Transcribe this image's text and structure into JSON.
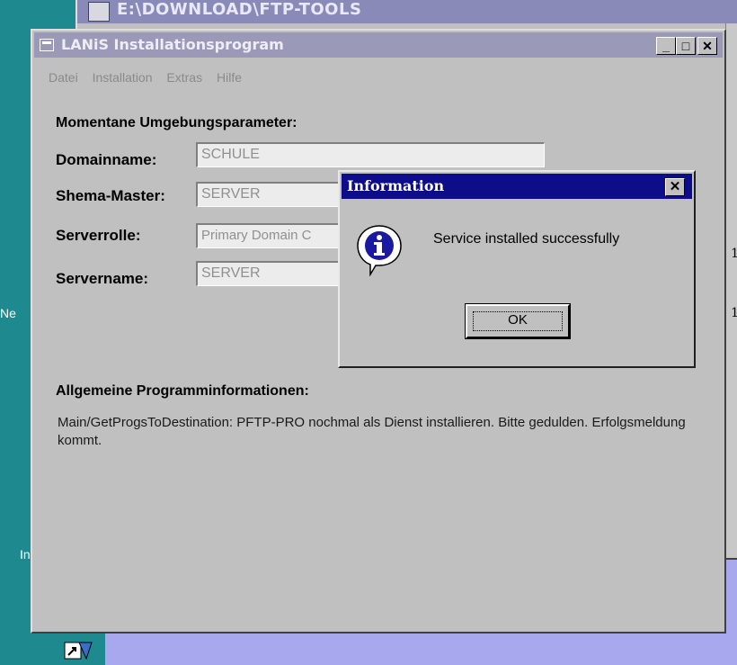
{
  "background_window": {
    "title": "E:\\DOWNLOAD\\FTP-TOOLS",
    "side_labels": [
      "1",
      "1"
    ],
    "left_labels": [
      "Ne",
      "In"
    ]
  },
  "main_window": {
    "title": "LANiS Installationsprogram",
    "controls": {
      "minimize": "_",
      "maximize": "□",
      "close": "✕"
    },
    "menu": [
      "Datei",
      "Installation",
      "Extras",
      "Hilfe"
    ],
    "params_heading": "Momentane Umgebungsparameter:",
    "fields": [
      {
        "label": "Domainname:",
        "value": "SCHULE"
      },
      {
        "label": "Shema-Master:",
        "value": "SERVER"
      },
      {
        "label": "Serverrolle:",
        "value": "Primary Domain C"
      },
      {
        "label": "Servername:",
        "value": "SERVER"
      }
    ],
    "info_heading": "Allgemeine Programminformationen:",
    "info_text": "Main/GetProgsToDestination: PFTP-PRO nochmal als Dienst installieren. Bitte gedulden. Erfolgsmeldung kommt."
  },
  "dialog": {
    "title": "Information",
    "close": "✕",
    "icon": "info-icon",
    "message": "Service installed successfully",
    "ok_label": "OK"
  },
  "colors": {
    "desktop": "#1e8a8f",
    "outer_bg": "#a8a8ee",
    "dialog_title": "#0d0d8a",
    "window_face": "#c0c0c0"
  }
}
